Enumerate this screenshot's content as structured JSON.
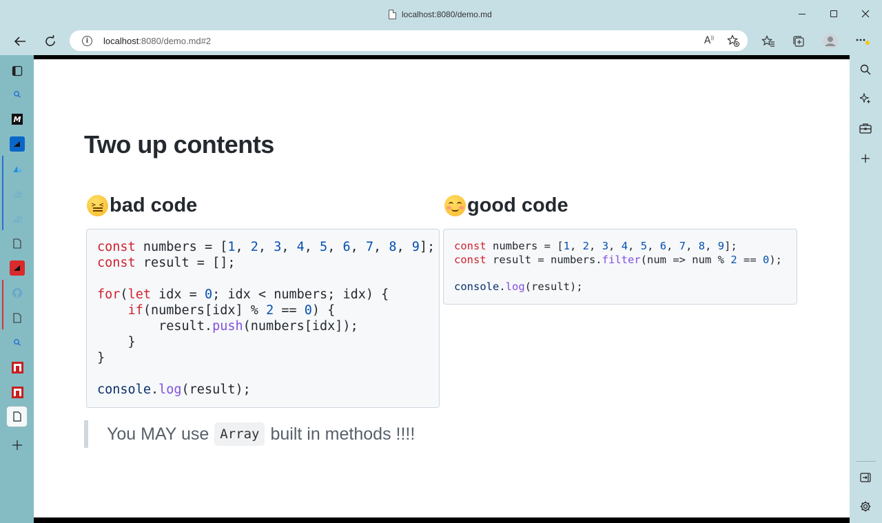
{
  "window": {
    "title": "localhost:8080/demo.md"
  },
  "toolbar": {
    "url_host": "localhost",
    "url_rest": ":8080/demo.md#2",
    "read_aloud_label": "A",
    "read_aloud_sup": "))"
  },
  "sidebar_left": {
    "items": [
      {
        "icon": "sidebar-toggle-icon"
      },
      {
        "icon": "search-icon"
      },
      {
        "icon": "medium-logo-icon",
        "label": "M"
      },
      {
        "icon": "azure-icon"
      },
      {
        "icon": "azure-icon"
      },
      {
        "icon": "azure-icon"
      },
      {
        "icon": "azure-icon"
      },
      {
        "icon": "document-icon"
      },
      {
        "icon": "red-app-icon"
      },
      {
        "icon": "github-icon"
      },
      {
        "icon": "document-icon"
      },
      {
        "icon": "search-icon"
      },
      {
        "icon": "red-app-icon"
      },
      {
        "icon": "red-app-icon"
      },
      {
        "icon": "document-icon"
      },
      {
        "icon": "add-tab-icon"
      }
    ]
  },
  "page": {
    "title": "Two up contents",
    "left": {
      "heading": "bad code",
      "emoji": "confounded-face"
    },
    "right": {
      "heading": "good code",
      "emoji": "smiling-face-with-smiling-eyes"
    },
    "blockquote": {
      "before": "You MAY use",
      "code": "Array",
      "after": "built in methods !!!!"
    }
  },
  "colors": {
    "keyword": "#cf222e",
    "number": "#0550ae",
    "function": "#8250df",
    "object": "#0a3069",
    "chrome": "#c6dfe4",
    "sidebar": "#85bcc4"
  }
}
